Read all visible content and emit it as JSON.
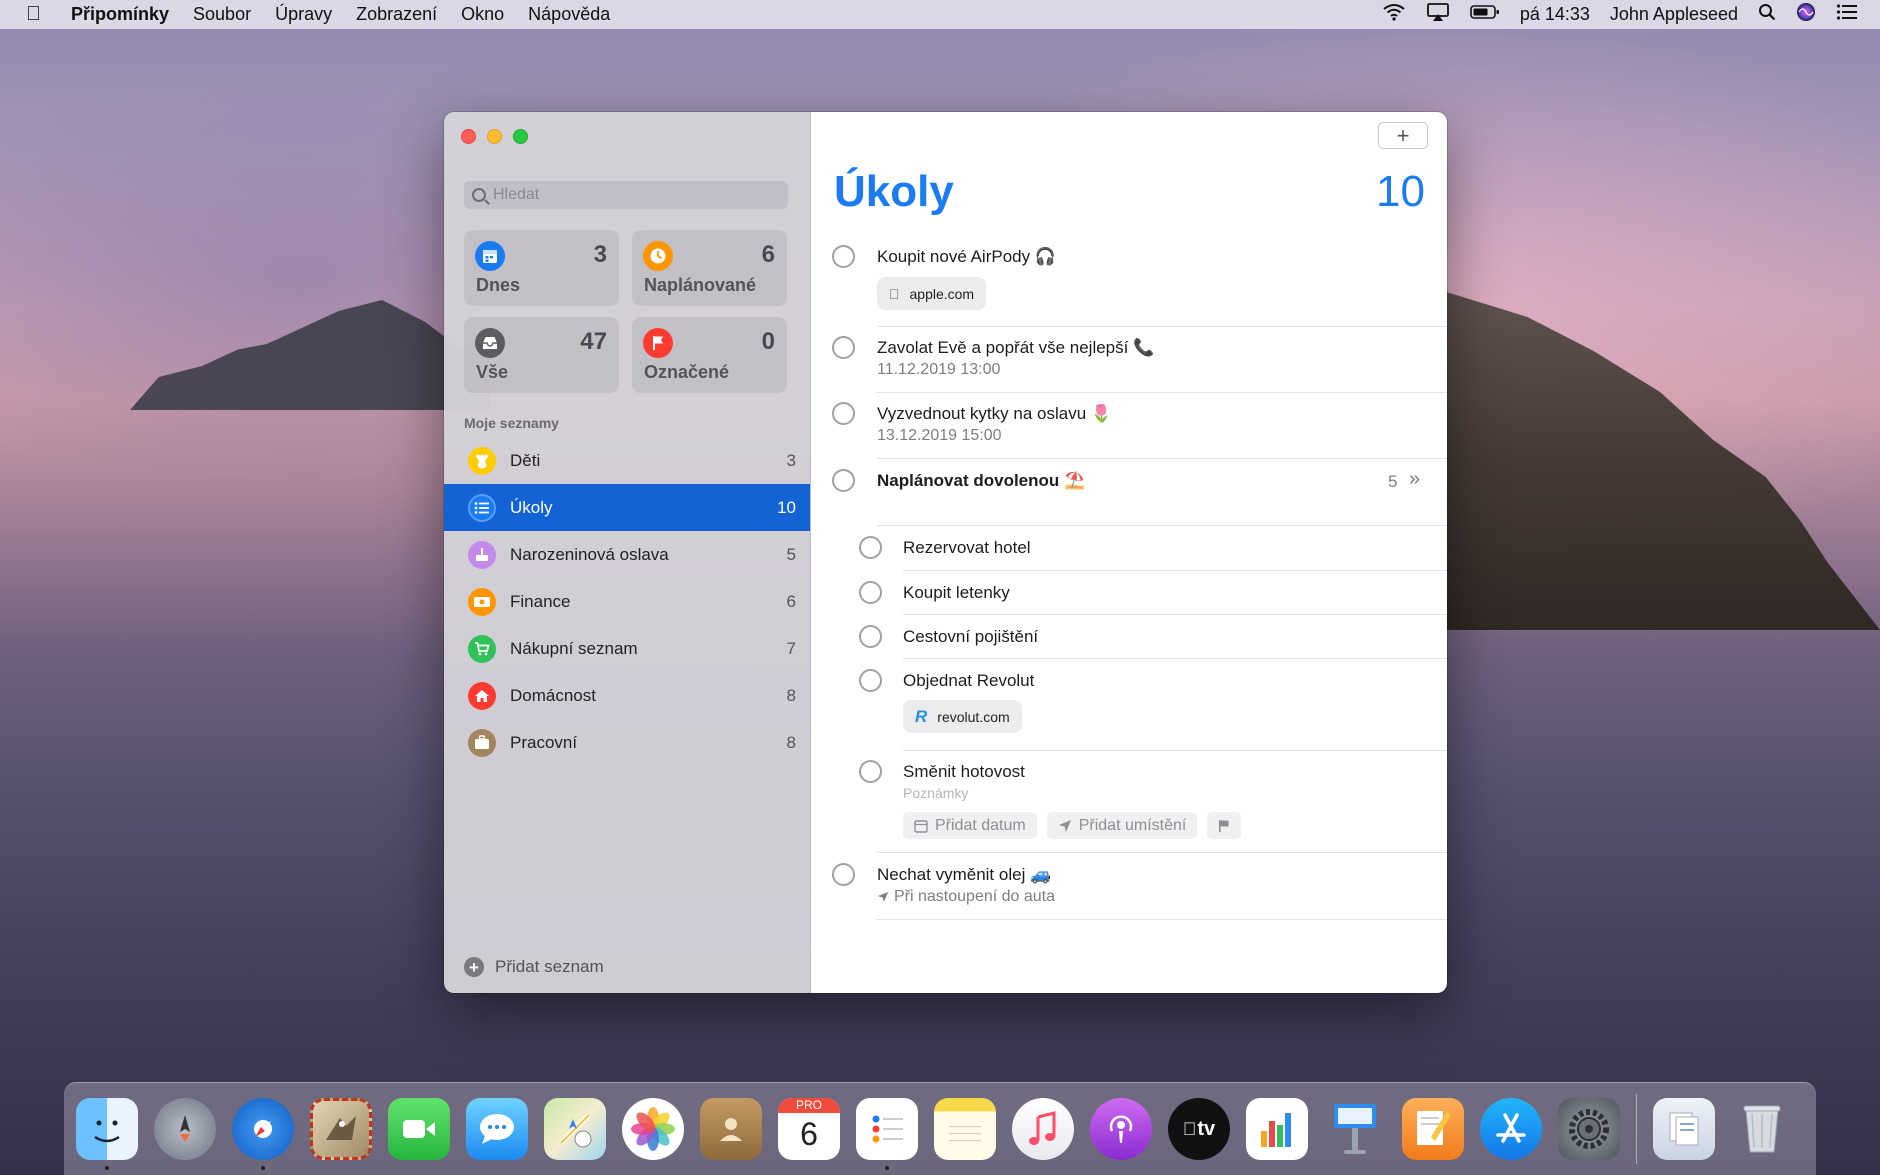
{
  "menubar": {
    "apple": "",
    "app_name": "Připomínky",
    "menus": [
      "Soubor",
      "Úpravy",
      "Zobrazení",
      "Okno",
      "Nápověda"
    ],
    "clock": "pá 14:33",
    "user": "John Appleseed"
  },
  "sidebar": {
    "search_placeholder": "Hledat",
    "smart_lists": [
      {
        "label": "Dnes",
        "count": "3",
        "color": "#1a7cf5",
        "icon": "calendar-icon"
      },
      {
        "label": "Naplánované",
        "count": "6",
        "color": "#ff9500",
        "icon": "clock-icon"
      },
      {
        "label": "Vše",
        "count": "47",
        "color": "#5c5c61",
        "icon": "tray-icon"
      },
      {
        "label": "Označené",
        "count": "0",
        "color": "#ff3b30",
        "icon": "flag-icon"
      }
    ],
    "lists_header": "Moje seznamy",
    "lists": [
      {
        "name": "Děti",
        "count": "3",
        "color": "#ffcc00",
        "icon": "teddy-icon"
      },
      {
        "name": "Úkoly",
        "count": "10",
        "color": "#1a7cf5",
        "icon": "list-icon",
        "selected": true
      },
      {
        "name": "Narozeninová oslava",
        "count": "5",
        "color": "#c38aeb",
        "icon": "cake-icon"
      },
      {
        "name": "Finance",
        "count": "6",
        "color": "#ff9500",
        "icon": "money-icon"
      },
      {
        "name": "Nákupní seznam",
        "count": "7",
        "color": "#30c158",
        "icon": "cart-icon"
      },
      {
        "name": "Domácnost",
        "count": "8",
        "color": "#ff3b30",
        "icon": "house-icon"
      },
      {
        "name": "Pracovní",
        "count": "8",
        "color": "#a2845e",
        "icon": "briefcase-icon"
      }
    ],
    "add_list": "Přidat seznam"
  },
  "main": {
    "add_button": "+",
    "title": "Úkoly",
    "count": "10",
    "tasks": [
      {
        "title": "Koupit nové AirPody 🎧",
        "link": "apple.com"
      },
      {
        "title": "Zavolat Evě a popřát vše nejlepší 📞",
        "date": "11.12.2019 13:00"
      },
      {
        "title": "Vyzvednout kytky na oslavu 🌷",
        "date": "13.12.2019 15:00"
      },
      {
        "title": "Naplánovat dovolenou ⛱️",
        "subcount": "5",
        "chevron": "»"
      },
      {
        "title": "Rezervovat hotel"
      },
      {
        "title": "Koupit letenky"
      },
      {
        "title": "Cestovní pojištění"
      },
      {
        "title": "Objednat Revolut",
        "link": "revolut.com"
      },
      {
        "title": "Směnit hotovost",
        "notes_placeholder": "Poznámky",
        "actions": [
          "Přidat datum",
          "Přidat umístění"
        ]
      },
      {
        "title": "Nechat vyměnit olej 🚙",
        "location": "Při nastoupení do auta"
      }
    ]
  },
  "dock": {
    "icons": [
      "finder-icon",
      "launchpad-icon",
      "safari-icon",
      "mail-icon",
      "facetime-icon",
      "messages-icon",
      "maps-icon",
      "photos-icon",
      "contacts-icon",
      "calendar-icon",
      "reminders-icon",
      "notes-icon",
      "music-icon",
      "podcasts-icon",
      "tv-icon",
      "numbers-icon",
      "keynote-icon",
      "pages-icon",
      "app-store-icon",
      "system-preferences-icon",
      "downloads-icon",
      "trash-icon"
    ],
    "calendar_month": "PRO",
    "calendar_day": "6",
    "tv_label": "tv"
  }
}
